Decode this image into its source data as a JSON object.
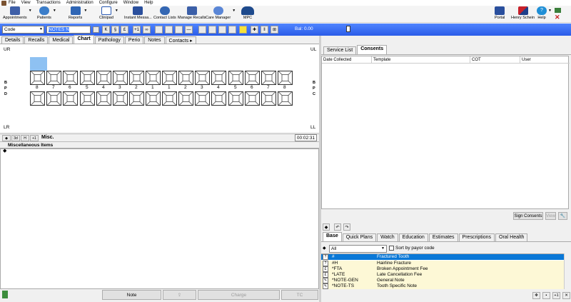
{
  "menu": [
    "File",
    "View",
    "Transactions",
    "Administration",
    "Configure",
    "Window",
    "Help"
  ],
  "toolbar": {
    "appointments": "Appointments",
    "patients": "Patients",
    "reports": "Reports",
    "clinipad": "Clinipad",
    "instant_messages": "Instant Messa...",
    "contact_lists": "Contact Lists",
    "manage_recalls": "Manage Recalls",
    "care_manager": "Care Manager",
    "mpc": "MPC",
    "portal": "Portal",
    "user": "Henry Schein",
    "help": "Help"
  },
  "bluebar": {
    "code_select": "Code",
    "notes_value": "NOTES N",
    "buttons": [
      "K",
      "§",
      "£",
      "+1",
      "∞"
    ],
    "balance": "Bal: 0.00"
  },
  "chart_tabs": [
    "Details",
    "Recalls",
    "Medical",
    "Chart",
    "Pathology",
    "Perio",
    "Notes",
    "Contacts"
  ],
  "chart": {
    "corner_ur": "UR",
    "corner_ul": "UL",
    "corner_lr": "LR",
    "corner_ll": "LL",
    "upper_numbers": [
      "8",
      "7",
      "6",
      "5",
      "4",
      "3",
      "2",
      "1",
      "1",
      "2",
      "3",
      "4",
      "5",
      "6",
      "7",
      "8"
    ],
    "side_left": "B\nP\nD",
    "side_right": "B\nP\nC"
  },
  "misc": {
    "buttons": [
      "◆",
      "3d",
      "H",
      "+1"
    ],
    "title": "Misc.",
    "timer": "00:02:31",
    "header": "Miscellaneous Items"
  },
  "bottom_buttons": {
    "note": "Note",
    "charge": "Charge",
    "tc": "TC"
  },
  "right_tabs": [
    "Service List",
    "Consents"
  ],
  "grid_headers": [
    "Date Collected",
    "Template",
    "COT",
    "User"
  ],
  "right_buttons": {
    "sign_consents": "Sign Consents",
    "view": "View"
  },
  "code_tabs": [
    "Base",
    "Quick Plans",
    "Watch",
    "Education",
    "Estimates",
    "Prescriptions",
    "Oral Health"
  ],
  "filter": {
    "value": "All",
    "sort_label": "Sort by payor code"
  },
  "codes": [
    {
      "code": "#",
      "desc": "Fractured Tooth"
    },
    {
      "code": "#H",
      "desc": "Hairline Fracture"
    },
    {
      "code": "*FTA",
      "desc": "Broken Appointment Fee"
    },
    {
      "code": "*LATE",
      "desc": "Late Cancellation Fee"
    },
    {
      "code": "*NOTE-GEN",
      "desc": "General Note"
    },
    {
      "code": "*NOTE-TS",
      "desc": "Tooth Specific Note"
    }
  ]
}
